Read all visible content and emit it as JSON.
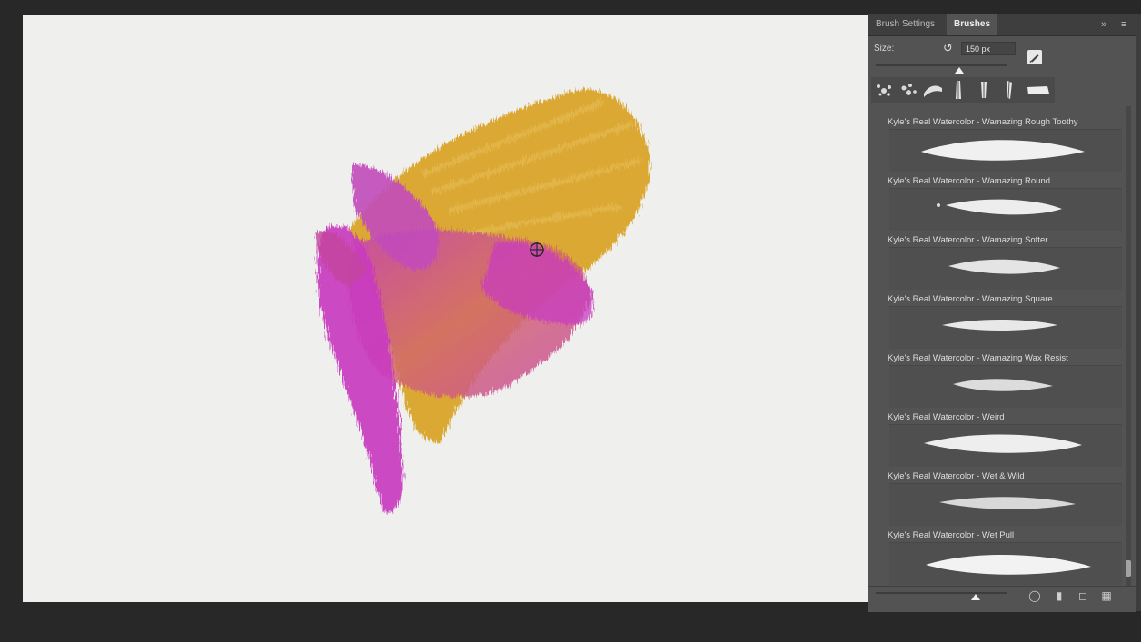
{
  "panel": {
    "tabs": [
      {
        "label": "Brush Settings"
      },
      {
        "label": "Brushes"
      }
    ],
    "active_tab": "Brushes",
    "size_label": "Size:",
    "size_value": "150 px",
    "collapse_icon": "double-chevron-icon",
    "menu_icon": "panel-menu-icon"
  },
  "brushes": [
    {
      "label": "Kyle's Real Watercolor - Wamazing Rough Toothy"
    },
    {
      "label": "Kyle's Real Watercolor - Wamazing Round"
    },
    {
      "label": "Kyle's Real Watercolor - Wamazing Softer"
    },
    {
      "label": "Kyle's Real Watercolor - Wamazing Square"
    },
    {
      "label": "Kyle's Real Watercolor - Wamazing Wax Resist"
    },
    {
      "label": "Kyle's Real Watercolor - Weird"
    },
    {
      "label": "Kyle's Real Watercolor - Wet & Wild"
    },
    {
      "label": "Kyle's Real Watercolor - Wet Pull"
    }
  ],
  "colors": {
    "canvas": "#efefee",
    "paint_yellow": "#d9a52a",
    "paint_magenta": "#c93ac0",
    "panel_bg": "#535353"
  },
  "bottom_icons": [
    "toggle-preview-icon",
    "folder-icon",
    "new-brush-icon",
    "trash-icon"
  ]
}
